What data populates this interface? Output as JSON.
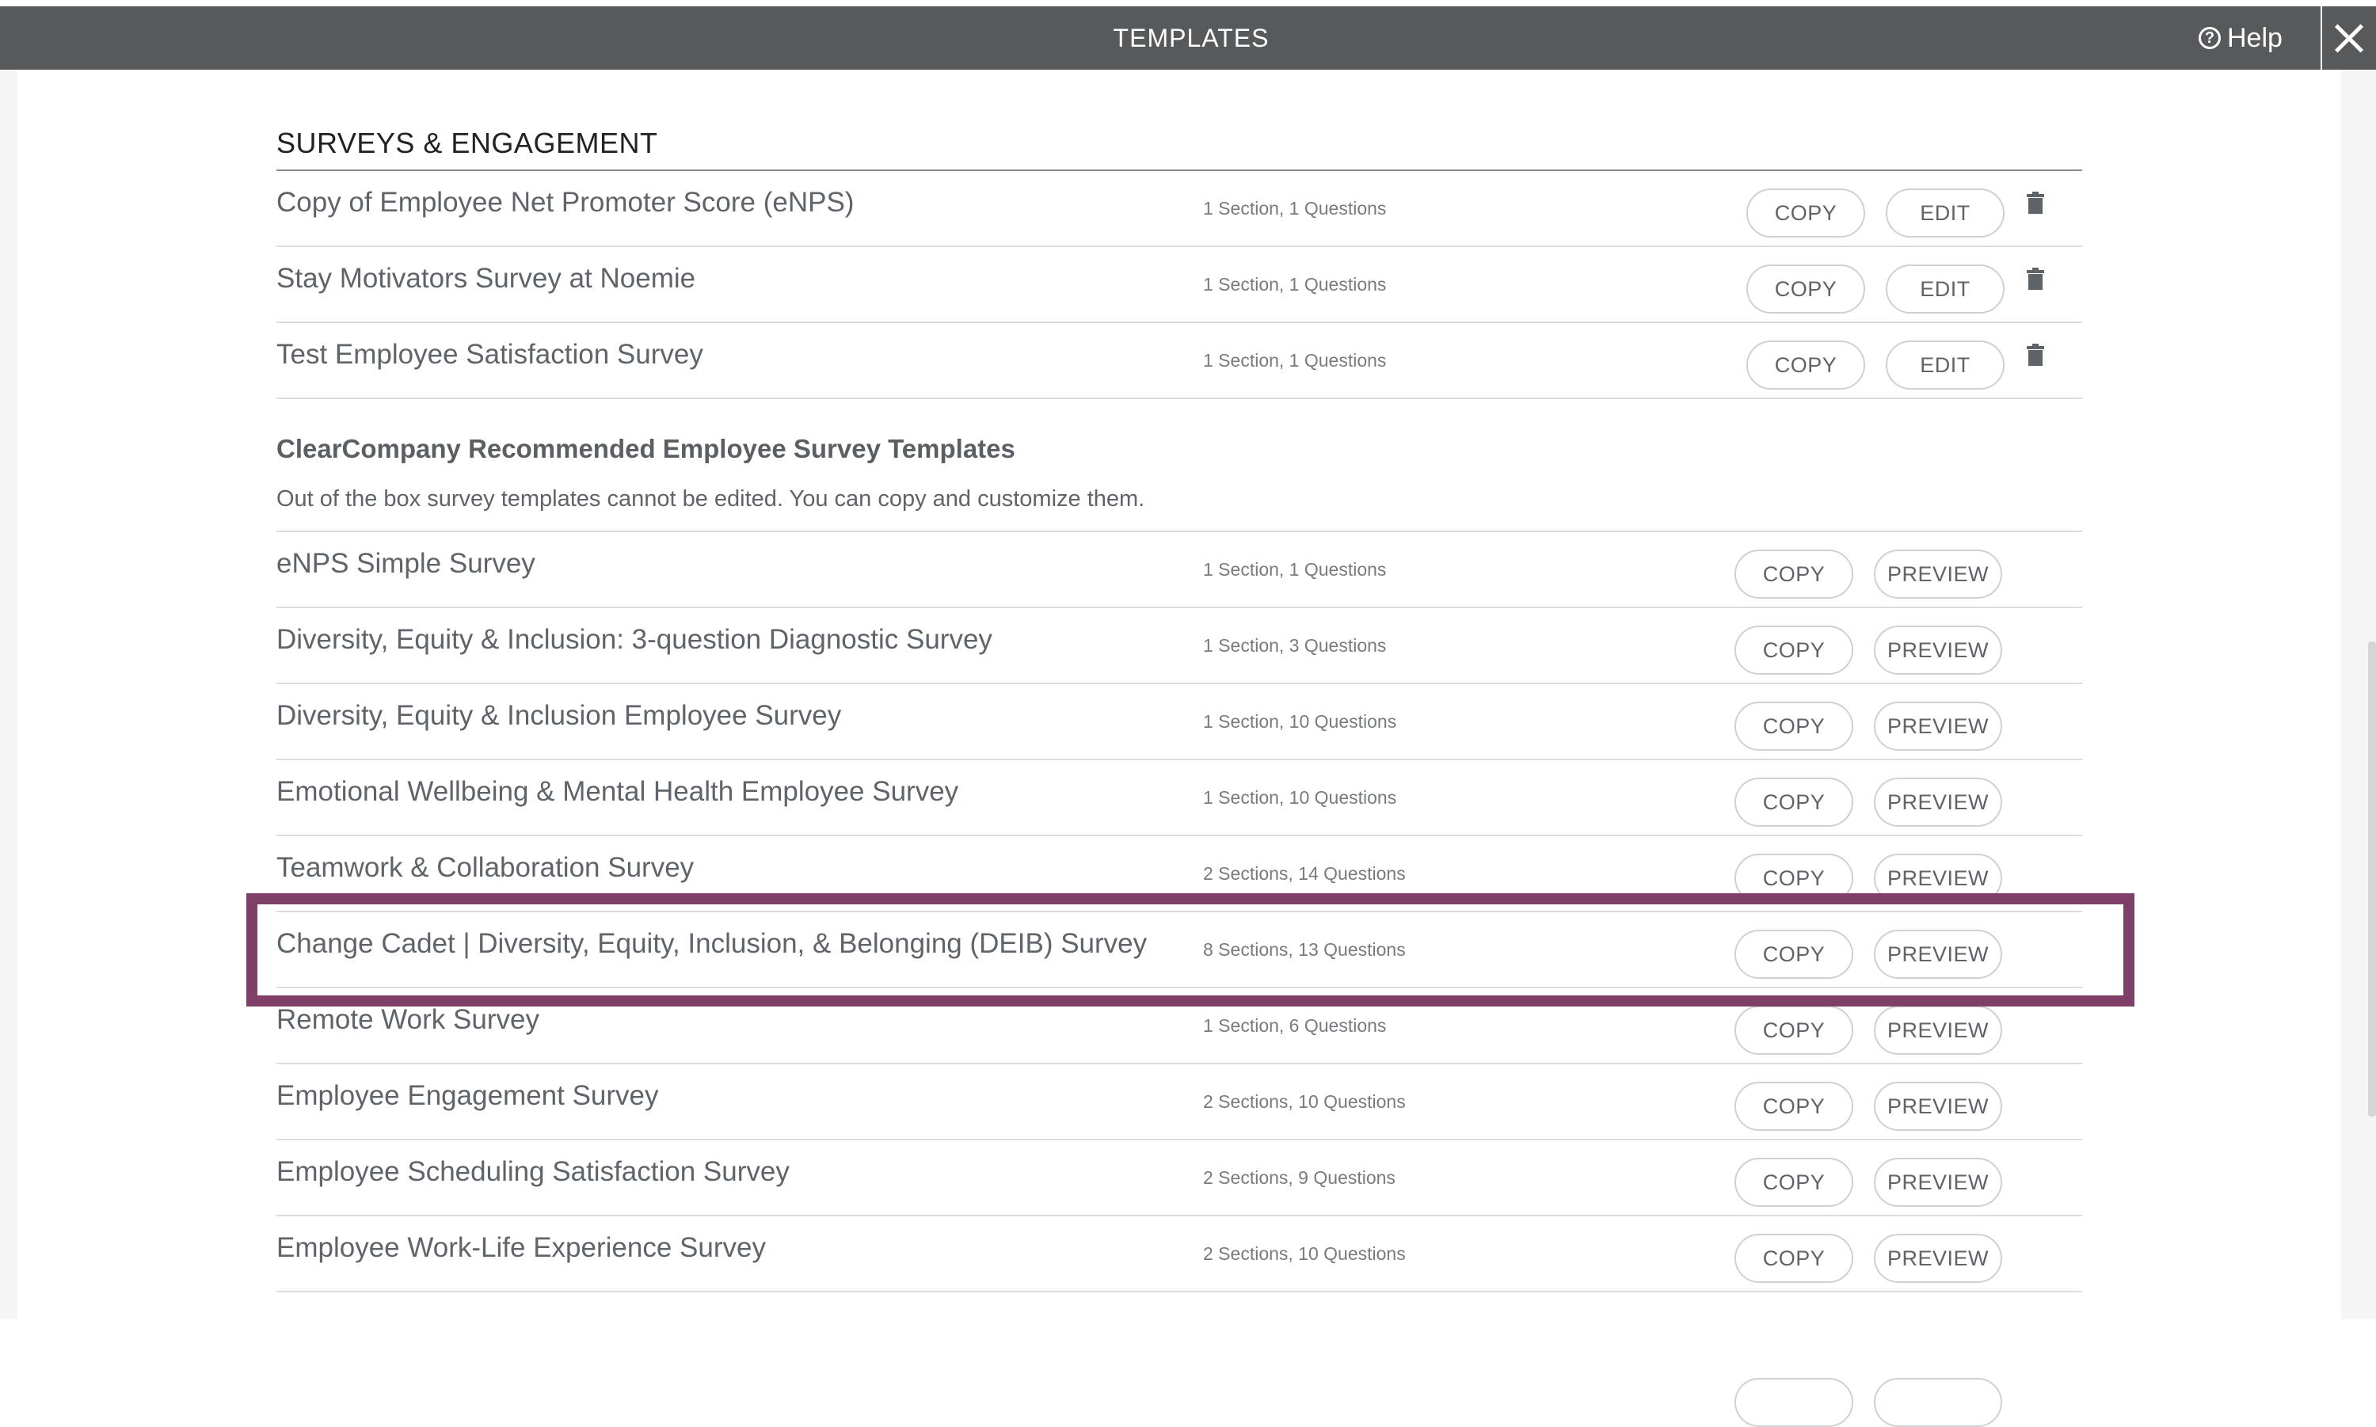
{
  "header": {
    "title": "TEMPLATES",
    "help_label": "Help",
    "help_icon": "question-circle-icon",
    "close_icon": "close-icon"
  },
  "own_section": {
    "title": "SURVEYS & ENGAGEMENT",
    "rows": [
      {
        "name": "Copy of Employee Net Promoter Score (eNPS)",
        "meta": "1 Section, 1 Questions",
        "copy": "COPY",
        "edit": "EDIT"
      },
      {
        "name": "Stay Motivators Survey at Noemie",
        "meta": "1 Section, 1 Questions",
        "copy": "COPY",
        "edit": "EDIT"
      },
      {
        "name": "Test Employee Satisfaction Survey",
        "meta": "1 Section, 1 Questions",
        "copy": "COPY",
        "edit": "EDIT"
      }
    ]
  },
  "recommended": {
    "title": "ClearCompany Recommended Employee Survey Templates",
    "description": "Out of the box survey templates cannot be edited. You can copy and customize them.",
    "rows": [
      {
        "name": "eNPS Simple Survey",
        "meta": "1 Section, 1 Questions",
        "copy": "COPY",
        "preview": "PREVIEW"
      },
      {
        "name": "Diversity, Equity & Inclusion: 3-question Diagnostic Survey",
        "meta": "1 Section, 3 Questions",
        "copy": "COPY",
        "preview": "PREVIEW"
      },
      {
        "name": "Diversity, Equity & Inclusion Employee Survey",
        "meta": "1 Section, 10 Questions",
        "copy": "COPY",
        "preview": "PREVIEW"
      },
      {
        "name": "Emotional Wellbeing & Mental Health Employee Survey",
        "meta": "1 Section, 10 Questions",
        "copy": "COPY",
        "preview": "PREVIEW"
      },
      {
        "name": "Teamwork & Collaboration Survey",
        "meta": "2 Sections, 14 Questions",
        "copy": "COPY",
        "preview": "PREVIEW"
      },
      {
        "name": "Change Cadet | Diversity, Equity, Inclusion, & Belonging (DEIB) Survey",
        "meta": "8 Sections, 13 Questions",
        "copy": "COPY",
        "preview": "PREVIEW"
      },
      {
        "name": "Remote Work Survey",
        "meta": "1 Section, 6 Questions",
        "copy": "COPY",
        "preview": "PREVIEW"
      },
      {
        "name": "Employee Engagement Survey",
        "meta": "2 Sections, 10 Questions",
        "copy": "COPY",
        "preview": "PREVIEW"
      },
      {
        "name": "Employee Scheduling Satisfaction Survey",
        "meta": "2 Sections, 9 Questions",
        "copy": "COPY",
        "preview": "PREVIEW"
      },
      {
        "name": "Employee Work-Life Experience Survey",
        "meta": "2 Sections, 10 Questions",
        "copy": "COPY",
        "preview": "PREVIEW"
      }
    ]
  },
  "highlight_color": "#7f3f69"
}
